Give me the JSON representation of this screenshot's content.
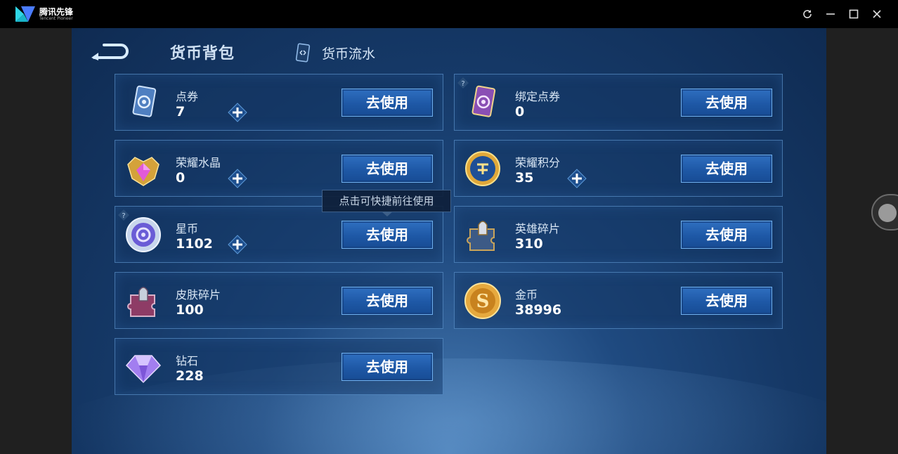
{
  "window": {
    "app_name": "腾讯先锋",
    "app_name_en": "Tencent Pioneer",
    "buttons": [
      "refresh-icon",
      "minimize-icon",
      "maximize-icon",
      "close-icon"
    ]
  },
  "header": {
    "title": "货币背包",
    "flow_label": "货币流水"
  },
  "tooltip": "点击可快捷前往使用",
  "use_label": "去使用",
  "currencies": [
    {
      "name": "点券",
      "value": "7",
      "icon": "coupon-card-icon"
    },
    {
      "name": "绑定点券",
      "value": "0",
      "icon": "bound-coupon-card-icon"
    },
    {
      "name": "荣耀水晶",
      "value": "0",
      "icon": "glory-crystal-icon"
    },
    {
      "name": "荣耀积分",
      "value": "35",
      "icon": "glory-points-icon"
    },
    {
      "name": "星币",
      "value": "1102",
      "icon": "star-coin-icon"
    },
    {
      "name": "英雄碎片",
      "value": "310",
      "icon": "hero-fragment-icon"
    },
    {
      "name": "皮肤碎片",
      "value": "100",
      "icon": "skin-fragment-icon"
    },
    {
      "name": "金币",
      "value": "38996",
      "icon": "gold-coin-icon"
    },
    {
      "name": "钻石",
      "value": "228",
      "icon": "diamond-icon"
    }
  ],
  "colors": {
    "accent_button": "#1e58a6",
    "card_border": "#6eaae6",
    "background": "#153866"
  }
}
